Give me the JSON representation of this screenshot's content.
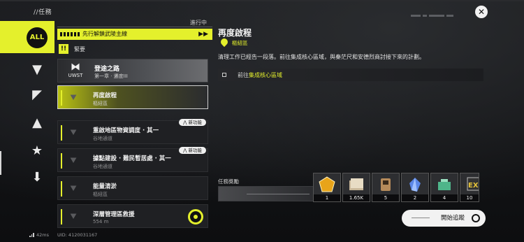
{
  "window": {
    "title": "//任務"
  },
  "status": {
    "label": "進行中"
  },
  "sidebar": {
    "all_label": "ALL",
    "categories": [
      {
        "name": "category-icon-1",
        "glyph": "▼"
      },
      {
        "name": "category-icon-2",
        "glyph": "◤"
      },
      {
        "name": "category-icon-3",
        "glyph": "▲"
      },
      {
        "name": "category-icon-4",
        "glyph": "★"
      },
      {
        "name": "category-icon-5",
        "glyph": "⬇"
      }
    ]
  },
  "quests": {
    "main_banner": "先行解鎖武陵主線",
    "urgent_badge": "!!",
    "urgent_label": "緊要",
    "chapter": {
      "logo_text": "UWST",
      "title": "登途之路",
      "subtitle": "第一章 · 遷度III"
    },
    "items": [
      {
        "title": "再度啟程",
        "region": "樞紐區",
        "active": true,
        "tag": ""
      },
      {
        "title": "重啟地區物資調度 · 其一",
        "region": "谷地通道",
        "active": false,
        "tag": "新功能"
      },
      {
        "title": "據點建設 · 難民暫居處 · 其一",
        "region": "谷地通道",
        "active": false,
        "tag": "新功能"
      },
      {
        "title": "能量清淤",
        "region": "樞紐區",
        "active": false,
        "tag": ""
      },
      {
        "title": "深層管理區救援",
        "region": "554 m",
        "active": false,
        "tag": ""
      }
    ]
  },
  "detail": {
    "title": "再度啟程",
    "location": "樞紐區",
    "description": "清理工作已經告一段落。前往集成核心區域，與秦茫尺和安德烈商討接下來的計劃。",
    "objective_prefix": "前往",
    "objective_highlight": "集成核心區域"
  },
  "rewards": {
    "label": "任務獎勵",
    "items": [
      {
        "name": "reward-gold-crystal",
        "count": "1",
        "color": "#e8a41a"
      },
      {
        "name": "reward-paper-stack",
        "count": "1.65K",
        "color": "#c9b89a"
      },
      {
        "name": "reward-device",
        "count": "5",
        "color": "#b58a5a"
      },
      {
        "name": "reward-blue-crystal",
        "count": "2",
        "color": "#5a86e6"
      },
      {
        "name": "reward-battery",
        "count": "4",
        "color": "#4fb58a"
      },
      {
        "name": "reward-ex",
        "count": "10",
        "color": "#e4c23a"
      }
    ]
  },
  "actions": {
    "start_tracking": "開始追蹤"
  },
  "footer": {
    "ping": "42ms",
    "uid": "UID: 4120031167"
  }
}
